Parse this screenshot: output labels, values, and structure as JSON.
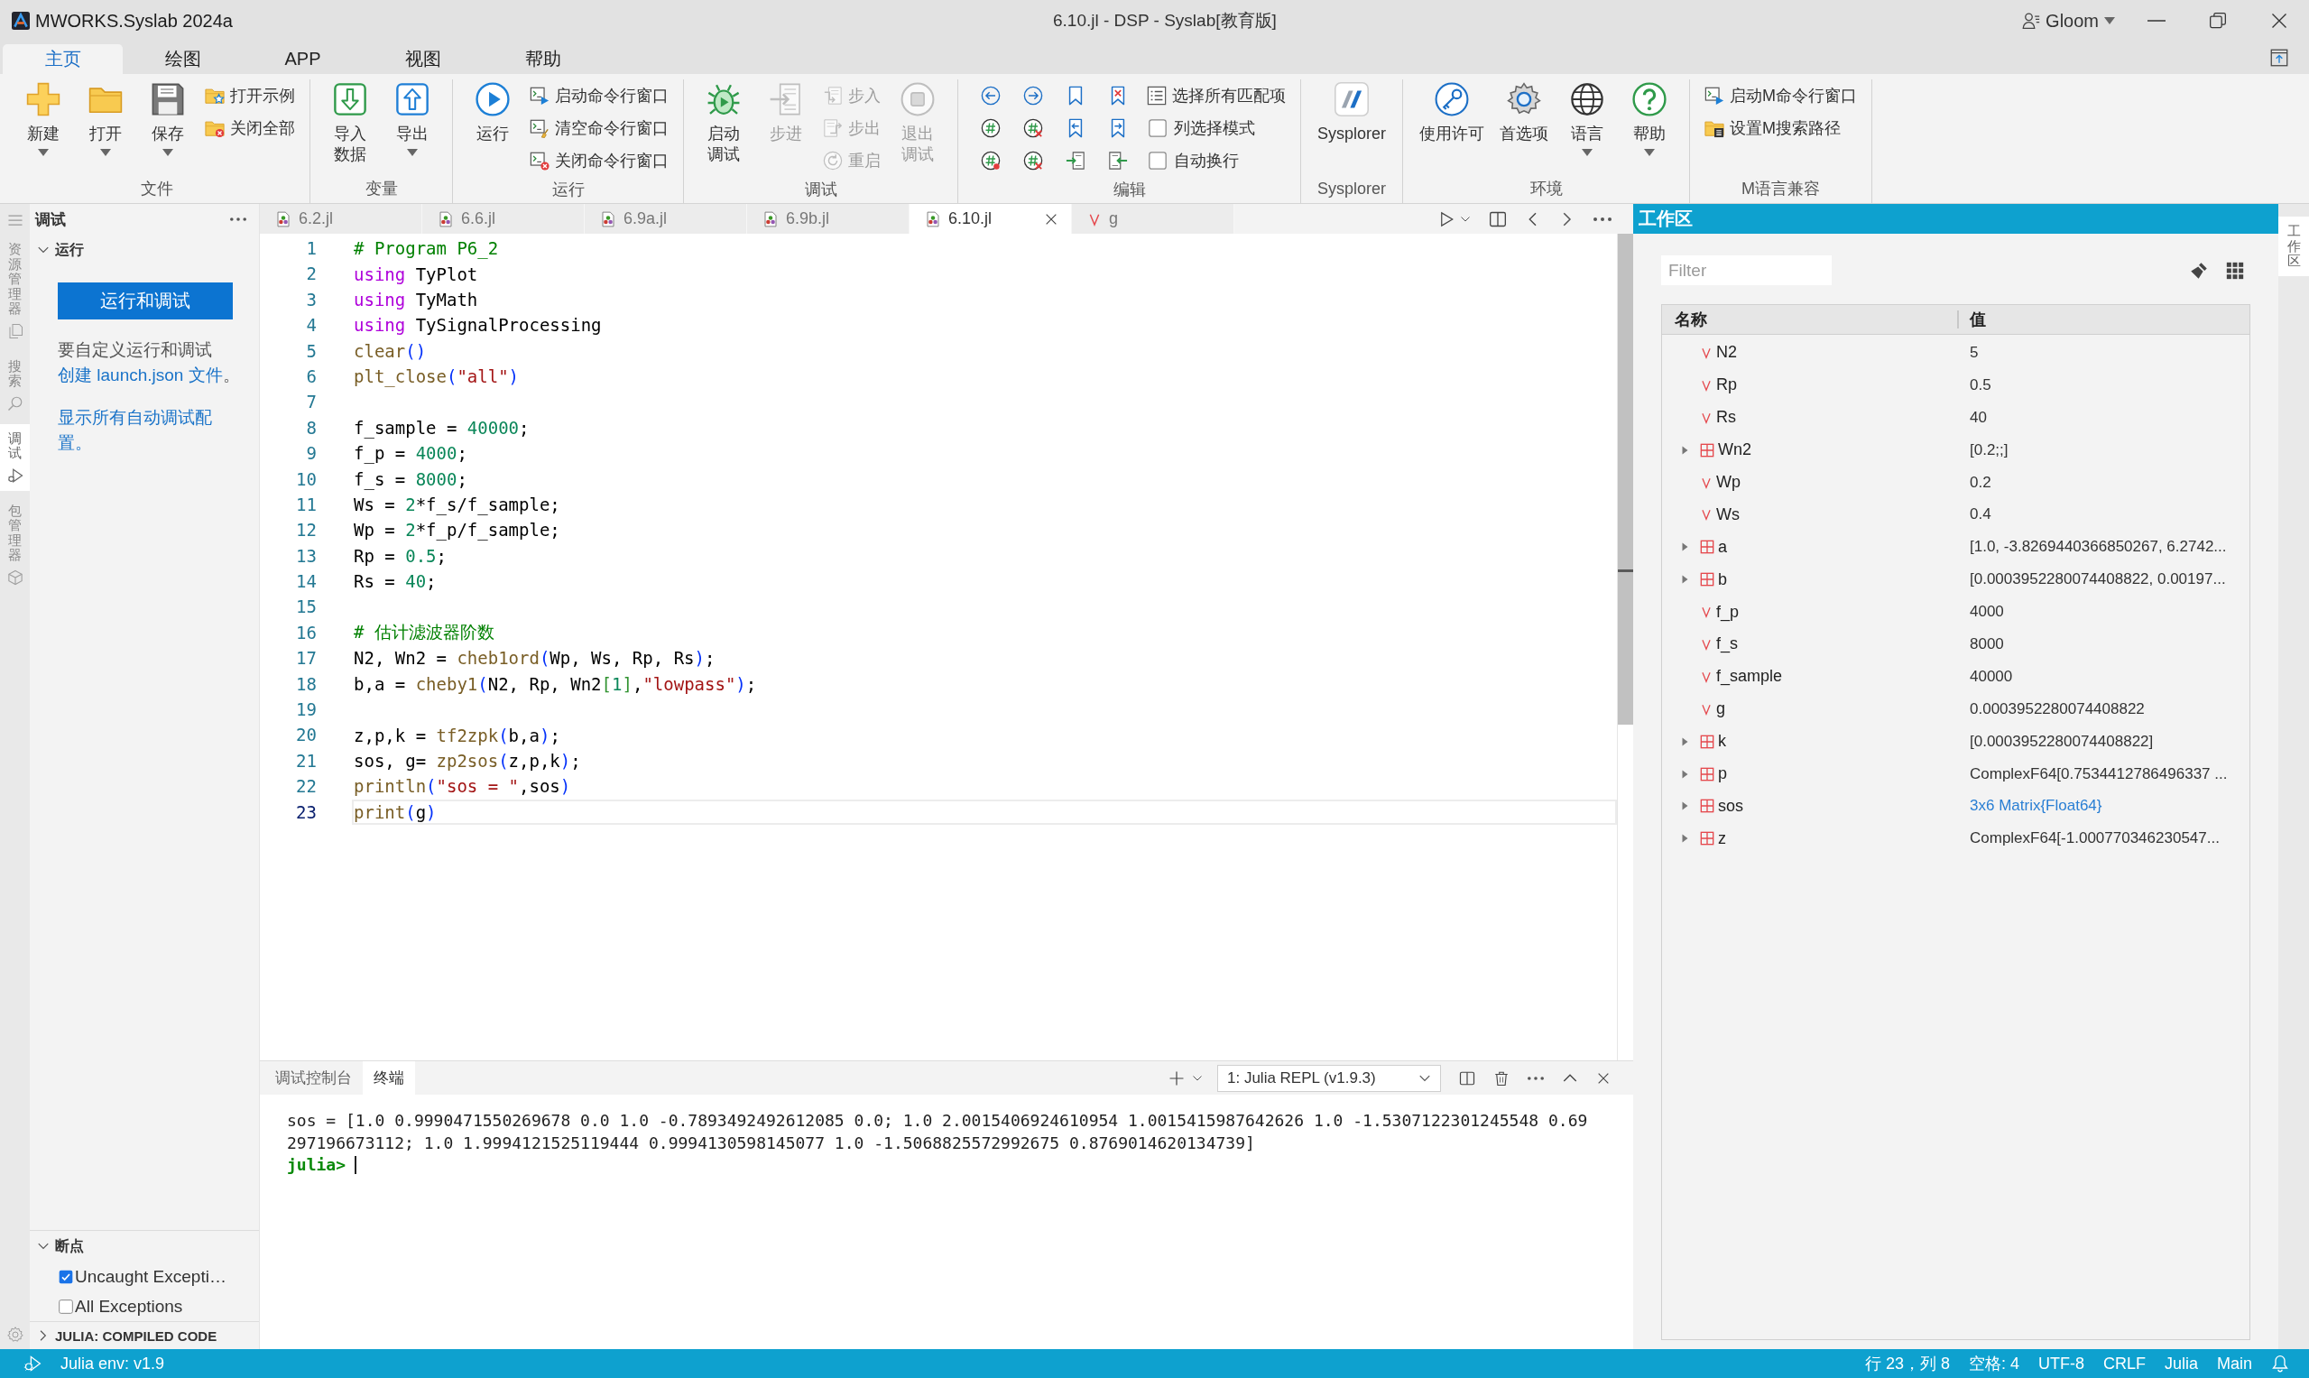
{
  "title_bar": {
    "app_name": "MWORKS.Syslab 2024a",
    "document_title": "6.10.jl - DSP - Syslab[教育版]",
    "user": "Gloom"
  },
  "ribbon_tabs": [
    {
      "label": "主页",
      "selected": true
    },
    {
      "label": "绘图",
      "selected": false
    },
    {
      "label": "APP",
      "selected": false
    },
    {
      "label": "视图",
      "selected": false
    },
    {
      "label": "帮助",
      "selected": false
    }
  ],
  "ribbon_groups": [
    {
      "label": "文件",
      "items": [
        {
          "kind": "large",
          "label": "新建",
          "dropdown": true,
          "disabled": false
        },
        {
          "kind": "large",
          "label": "打开",
          "dropdown": true,
          "disabled": false
        },
        {
          "kind": "large",
          "label": "保存",
          "dropdown": true,
          "disabled": false
        },
        {
          "kind": "small",
          "label": "打开示例",
          "disabled": false
        },
        {
          "kind": "small",
          "label": "关闭全部",
          "disabled": false
        }
      ]
    },
    {
      "label": "变量",
      "items": [
        {
          "kind": "large",
          "lines": [
            "导入",
            "数据"
          ],
          "dropdown": false,
          "disabled": false
        },
        {
          "kind": "large",
          "label": "导出",
          "dropdown": true,
          "disabled": false
        }
      ]
    },
    {
      "label": "运行",
      "items": [
        {
          "kind": "large",
          "label": "运行",
          "dropdown": false,
          "disabled": false
        },
        {
          "kind": "small",
          "label": "启动命令行窗口",
          "disabled": false
        },
        {
          "kind": "small",
          "label": "清空命令行窗口",
          "disabled": false
        },
        {
          "kind": "small",
          "label": "关闭命令行窗口",
          "disabled": false
        }
      ]
    },
    {
      "label": "调试",
      "items": [
        {
          "kind": "large",
          "lines": [
            "启动",
            "调试"
          ],
          "dropdown": false,
          "disabled": false
        },
        {
          "kind": "large",
          "label": "步进",
          "dropdown": false,
          "disabled": true
        },
        {
          "kind": "small",
          "label": "步入",
          "disabled": true
        },
        {
          "kind": "small",
          "label": "步出",
          "disabled": true
        },
        {
          "kind": "small",
          "label": "重启",
          "disabled": true
        },
        {
          "kind": "large",
          "lines": [
            "退出",
            "调试"
          ],
          "dropdown": false,
          "disabled": true
        }
      ]
    },
    {
      "label": "编辑",
      "items": [
        {
          "kind": "icon_grid",
          "disabled": false
        },
        {
          "kind": "small",
          "label": "选择所有匹配项",
          "disabled": false
        },
        {
          "kind": "checkbox",
          "label": "列选择模式",
          "checked": false,
          "disabled": false
        },
        {
          "kind": "checkbox",
          "label": "自动换行",
          "checked": false,
          "disabled": false
        }
      ]
    },
    {
      "label": "Sysplorer",
      "items": [
        {
          "kind": "large",
          "label": "Sysplorer",
          "dropdown": false,
          "disabled": false
        }
      ]
    },
    {
      "label": "环境",
      "items": [
        {
          "kind": "large",
          "label": "使用许可",
          "dropdown": false,
          "disabled": false
        },
        {
          "kind": "large",
          "label": "首选项",
          "dropdown": false,
          "disabled": false
        },
        {
          "kind": "large",
          "label": "语言",
          "dropdown": true,
          "disabled": false
        },
        {
          "kind": "large",
          "label": "帮助",
          "dropdown": true,
          "disabled": false
        }
      ]
    },
    {
      "label": "M语言兼容",
      "items": [
        {
          "kind": "small",
          "label": "启动M命令行窗口",
          "disabled": false
        },
        {
          "kind": "small",
          "label": "设置M搜索路径",
          "disabled": false
        }
      ]
    }
  ],
  "activity_bar": [
    {
      "label": "资源管理器",
      "selected": false
    },
    {
      "label": "搜索",
      "selected": false
    },
    {
      "label": "调试",
      "selected": true
    },
    {
      "label": "包管理器",
      "selected": false
    }
  ],
  "side_panel": {
    "title": "调试",
    "run": {
      "title": "运行",
      "expanded": true,
      "button": "运行和调试",
      "paragraphs": [
        [
          {
            "kind": "text",
            "text": "要自定义运行和调试"
          },
          {
            "kind": "link",
            "text": "创建 launch.json 文件"
          },
          {
            "kind": "text",
            "text": "。"
          }
        ],
        [
          {
            "kind": "link",
            "text": "显示所有自动调试配置。"
          }
        ]
      ]
    },
    "breakpoints": {
      "title": "断点",
      "expanded": true,
      "items": [
        {
          "label": "Uncaught Excepti…",
          "checked": true
        },
        {
          "label": "All Exceptions",
          "checked": false
        }
      ]
    },
    "compiled_code": {
      "title": "JULIA: COMPILED CODE",
      "expanded": false
    }
  },
  "editor": {
    "tabs": [
      {
        "kind": "file",
        "label": "6.2.jl",
        "selected": false
      },
      {
        "kind": "file",
        "label": "6.6.jl",
        "selected": false
      },
      {
        "kind": "file",
        "label": "6.9a.jl",
        "selected": false
      },
      {
        "kind": "file",
        "label": "6.9b.jl",
        "selected": false
      },
      {
        "kind": "file",
        "label": "6.10.jl",
        "selected": true
      },
      {
        "kind": "variable",
        "label": "g",
        "selected": false
      }
    ],
    "lines": [
      {
        "number": "1",
        "current": false,
        "tokens": [
          {
            "kind": "comment",
            "text": "# Program P6_2"
          }
        ]
      },
      {
        "number": "2",
        "current": false,
        "tokens": [
          {
            "kind": "keyword",
            "text": "using"
          },
          {
            "kind": "plain",
            "text": " TyPlot"
          }
        ]
      },
      {
        "number": "3",
        "current": false,
        "tokens": [
          {
            "kind": "keyword",
            "text": "using"
          },
          {
            "kind": "plain",
            "text": " TyMath"
          }
        ]
      },
      {
        "number": "4",
        "current": false,
        "tokens": [
          {
            "kind": "keyword",
            "text": "using"
          },
          {
            "kind": "plain",
            "text": " TySignalProcessing"
          }
        ]
      },
      {
        "number": "5",
        "current": false,
        "tokens": [
          {
            "kind": "function",
            "text": "clear"
          },
          {
            "kind": "paren",
            "text": "()"
          }
        ]
      },
      {
        "number": "6",
        "current": false,
        "tokens": [
          {
            "kind": "function",
            "text": "plt_close"
          },
          {
            "kind": "paren",
            "text": "("
          },
          {
            "kind": "string",
            "text": "\"all\""
          },
          {
            "kind": "paren",
            "text": ")"
          }
        ]
      },
      {
        "number": "7",
        "current": false
      },
      {
        "number": "8",
        "current": false,
        "tokens": [
          {
            "kind": "plain",
            "text": "f_sample = "
          },
          {
            "kind": "number",
            "text": "40000"
          },
          {
            "kind": "plain",
            "text": ";"
          }
        ]
      },
      {
        "number": "9",
        "current": false,
        "tokens": [
          {
            "kind": "plain",
            "text": "f_p = "
          },
          {
            "kind": "number",
            "text": "4000"
          },
          {
            "kind": "plain",
            "text": ";"
          }
        ]
      },
      {
        "number": "10",
        "current": false,
        "tokens": [
          {
            "kind": "plain",
            "text": "f_s = "
          },
          {
            "kind": "number",
            "text": "8000"
          },
          {
            "kind": "plain",
            "text": ";"
          }
        ]
      },
      {
        "number": "11",
        "current": false,
        "tokens": [
          {
            "kind": "plain",
            "text": "Ws = "
          },
          {
            "kind": "number",
            "text": "2"
          },
          {
            "kind": "plain",
            "text": "*f_s/f_sample;"
          }
        ]
      },
      {
        "number": "12",
        "current": false,
        "tokens": [
          {
            "kind": "plain",
            "text": "Wp = "
          },
          {
            "kind": "number",
            "text": "2"
          },
          {
            "kind": "plain",
            "text": "*f_p/f_sample;"
          }
        ]
      },
      {
        "number": "13",
        "current": false,
        "tokens": [
          {
            "kind": "plain",
            "text": "Rp = "
          },
          {
            "kind": "number",
            "text": "0.5"
          },
          {
            "kind": "plain",
            "text": ";"
          }
        ]
      },
      {
        "number": "14",
        "current": false,
        "tokens": [
          {
            "kind": "plain",
            "text": "Rs = "
          },
          {
            "kind": "number",
            "text": "40"
          },
          {
            "kind": "plain",
            "text": ";"
          }
        ]
      },
      {
        "number": "15",
        "current": false
      },
      {
        "number": "16",
        "current": false,
        "tokens": [
          {
            "kind": "comment",
            "text": "# 估计滤波器阶数"
          }
        ]
      },
      {
        "number": "17",
        "current": false,
        "tokens": [
          {
            "kind": "plain",
            "text": "N2, Wn2 = "
          },
          {
            "kind": "function",
            "text": "cheb1ord"
          },
          {
            "kind": "paren",
            "text": "("
          },
          {
            "kind": "plain",
            "text": "Wp, Ws, Rp, Rs"
          },
          {
            "kind": "paren",
            "text": ")"
          },
          {
            "kind": "plain",
            "text": ";"
          }
        ]
      },
      {
        "number": "18",
        "current": false,
        "tokens": [
          {
            "kind": "plain",
            "text": "b,a = "
          },
          {
            "kind": "function",
            "text": "cheby1"
          },
          {
            "kind": "paren",
            "text": "("
          },
          {
            "kind": "plain",
            "text": "N2, Rp, Wn2"
          },
          {
            "kind": "bracket",
            "text": "["
          },
          {
            "kind": "number",
            "text": "1"
          },
          {
            "kind": "bracket",
            "text": "]"
          },
          {
            "kind": "plain",
            "text": ","
          },
          {
            "kind": "string",
            "text": "\"lowpass\""
          },
          {
            "kind": "paren",
            "text": ")"
          },
          {
            "kind": "plain",
            "text": ";"
          }
        ]
      },
      {
        "number": "19",
        "current": false
      },
      {
        "number": "20",
        "current": false,
        "tokens": [
          {
            "kind": "plain",
            "text": "z,p,k = "
          },
          {
            "kind": "function",
            "text": "tf2zpk"
          },
          {
            "kind": "paren",
            "text": "("
          },
          {
            "kind": "plain",
            "text": "b,a"
          },
          {
            "kind": "paren",
            "text": ")"
          },
          {
            "kind": "plain",
            "text": ";"
          }
        ]
      },
      {
        "number": "21",
        "current": false,
        "tokens": [
          {
            "kind": "plain",
            "text": "sos, g= "
          },
          {
            "kind": "function",
            "text": "zp2sos"
          },
          {
            "kind": "paren",
            "text": "("
          },
          {
            "kind": "plain",
            "text": "z,p,k"
          },
          {
            "kind": "paren",
            "text": ")"
          },
          {
            "kind": "plain",
            "text": ";"
          }
        ]
      },
      {
        "number": "22",
        "current": false,
        "tokens": [
          {
            "kind": "function",
            "text": "println"
          },
          {
            "kind": "paren",
            "text": "("
          },
          {
            "kind": "string",
            "text": "\"sos = \""
          },
          {
            "kind": "plain",
            "text": ",sos"
          },
          {
            "kind": "paren",
            "text": ")"
          }
        ]
      },
      {
        "number": "23",
        "current": true,
        "tokens": [
          {
            "kind": "function",
            "text": "print"
          },
          {
            "kind": "paren",
            "text": "("
          },
          {
            "kind": "plain",
            "text": "g"
          },
          {
            "kind": "paren",
            "text": ")"
          }
        ]
      }
    ]
  },
  "panel": {
    "tabs": [
      {
        "label": "调试控制台",
        "selected": false
      },
      {
        "label": "终端",
        "selected": true
      }
    ],
    "terminal_select": "1: Julia REPL (v1.9.3)",
    "output": [
      "sos = [1.0 0.9990471550269678 0.0 1.0 -0.7893492492612085 0.0; 1.0 2.0015406924610954 1.0015415987642626 1.0 -1.5307122301245548 0.69",
      "297196673112; 1.0 1.9994121525119444 0.9994130598145077 1.0 -1.5068825572992675 0.8769014620134739]"
    ],
    "prompt": "julia>"
  },
  "workspace": {
    "title": "工作区",
    "filter": {
      "placeholder": "Filter"
    },
    "columns": [
      "名称",
      "值"
    ],
    "rows": [
      {
        "kind": "scalar",
        "name": "N2",
        "value": "5"
      },
      {
        "kind": "scalar",
        "name": "Rp",
        "value": "0.5"
      },
      {
        "kind": "scalar",
        "name": "Rs",
        "value": "40"
      },
      {
        "kind": "array",
        "name": "Wn2",
        "value": "[0.2;;]",
        "expanded": false
      },
      {
        "kind": "scalar",
        "name": "Wp",
        "value": "0.2"
      },
      {
        "kind": "scalar",
        "name": "Ws",
        "value": "0.4"
      },
      {
        "kind": "array",
        "name": "a",
        "value": "[1.0, -3.8269440366850267, 6.2742...",
        "expanded": false
      },
      {
        "kind": "array",
        "name": "b",
        "value": "[0.0003952280074408822, 0.00197...",
        "expanded": false
      },
      {
        "kind": "scalar",
        "name": "f_p",
        "value": "4000"
      },
      {
        "kind": "scalar",
        "name": "f_s",
        "value": "8000"
      },
      {
        "kind": "scalar",
        "name": "f_sample",
        "value": "40000"
      },
      {
        "kind": "scalar",
        "name": "g",
        "value": "0.0003952280074408822"
      },
      {
        "kind": "array",
        "name": "k",
        "value": "[0.0003952280074408822]",
        "expanded": false
      },
      {
        "kind": "array",
        "name": "p",
        "value": "ComplexF64[0.7534412786496337 ...",
        "expanded": false
      },
      {
        "kind": "matrix",
        "name": "sos",
        "value": "3x6 Matrix{Float64}",
        "expanded": false
      },
      {
        "kind": "array",
        "name": "z",
        "value": "ComplexF64[-1.000770346230547...",
        "expanded": false
      }
    ]
  },
  "right_strip": {
    "tabs": [
      {
        "label": "工作区",
        "selected": true
      }
    ]
  },
  "status_bar": {
    "environment": "Julia env: v1.9",
    "items": [
      "行 23，列 8",
      "空格: 4",
      "UTF-8",
      "CRLF",
      "Julia",
      "Main"
    ]
  }
}
